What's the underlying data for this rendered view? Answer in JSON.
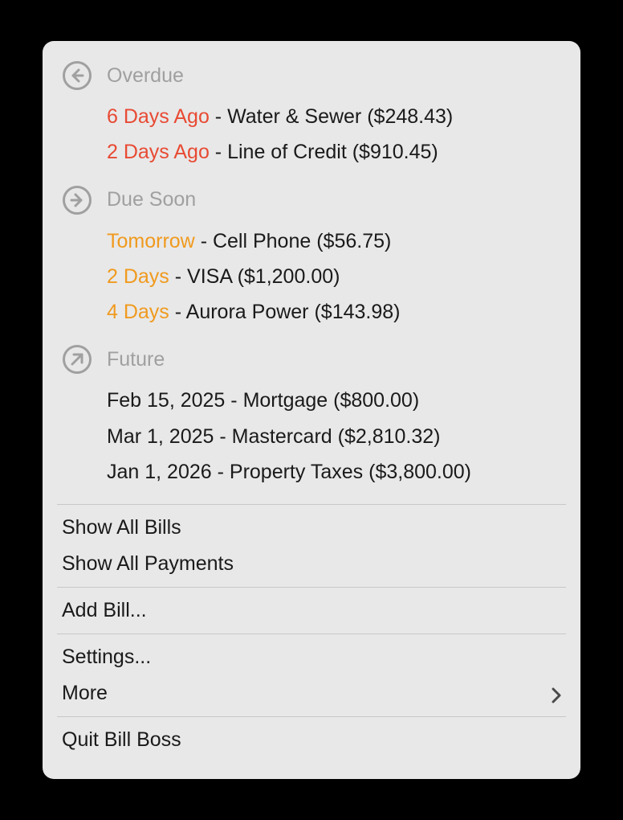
{
  "sections": {
    "overdue": {
      "title": "Overdue",
      "items": [
        {
          "date": "6 Days Ago",
          "sep": " - ",
          "name": "Water & Sewer",
          "amount": "($248.43)"
        },
        {
          "date": "2 Days Ago",
          "sep": " - ",
          "name": "Line of Credit",
          "amount": "($910.45)"
        }
      ]
    },
    "duesoon": {
      "title": "Due Soon",
      "items": [
        {
          "date": "Tomorrow",
          "sep": " - ",
          "name": "Cell Phone",
          "amount": "($56.75)"
        },
        {
          "date": "2 Days",
          "sep": " - ",
          "name": "VISA",
          "amount": "($1,200.00)"
        },
        {
          "date": "4 Days",
          "sep": " - ",
          "name": "Aurora Power",
          "amount": "($143.98)"
        }
      ]
    },
    "future": {
      "title": "Future",
      "items": [
        {
          "date": "Feb 15, 2025",
          "sep": " - ",
          "name": "Mortgage",
          "amount": "($800.00)"
        },
        {
          "date": "Mar 1, 2025",
          "sep": " - ",
          "name": "Mastercard",
          "amount": "($2,810.32)"
        },
        {
          "date": "Jan 1, 2026",
          "sep": " - ",
          "name": "Property Taxes",
          "amount": "($3,800.00)"
        }
      ]
    }
  },
  "menu": {
    "show_all_bills": "Show All Bills",
    "show_all_payments": "Show All Payments",
    "add_bill": "Add Bill...",
    "settings": "Settings...",
    "more": "More",
    "quit": "Quit Bill Boss"
  }
}
